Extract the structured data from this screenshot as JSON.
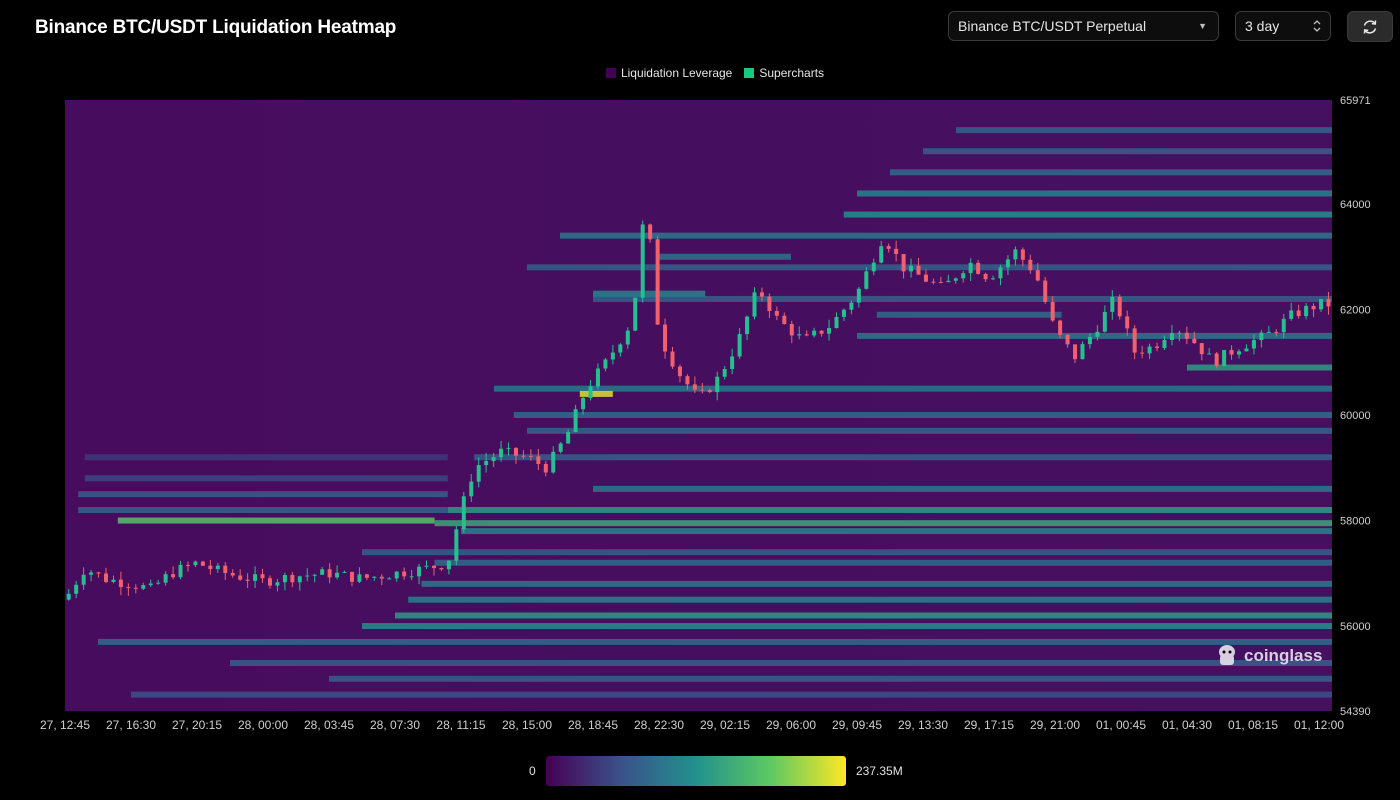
{
  "header": {
    "title": "Binance BTC/USDT Liquidation Heatmap",
    "pair_select": "Binance BTC/USDT Perpetual",
    "range_select": "3 day",
    "refresh_icon": "refresh-icon"
  },
  "legend": {
    "items": [
      {
        "label": "Liquidation Leverage",
        "color": "#440154"
      },
      {
        "label": "Supercharts",
        "color": "#1fc77e"
      }
    ]
  },
  "watermark": "coinglass",
  "colors": {
    "heatmap_low": "#440154",
    "heatmap_high": "#fde725",
    "candle_up": "#26c08e",
    "candle_down": "#f0616d"
  },
  "colorbar": {
    "min_label": "0",
    "max_label": "237.35M"
  },
  "chart_data": {
    "type": "heatmap",
    "title": "Binance BTC/USDT Liquidation Heatmap",
    "y_ticks": [
      "65971",
      "64000",
      "62000",
      "60000",
      "58000",
      "56000",
      "54390"
    ],
    "y_min": 54390,
    "y_max": 65971,
    "x_ticks": [
      "27, 12:45",
      "27, 16:30",
      "27, 20:15",
      "28, 00:00",
      "28, 03:45",
      "28, 07:30",
      "28, 11:15",
      "28, 15:00",
      "28, 18:45",
      "28, 22:30",
      "29, 02:15",
      "29, 06:00",
      "29, 09:45",
      "29, 13:30",
      "29, 17:15",
      "29, 21:00",
      "01, 00:45",
      "01, 04:30",
      "01, 08:15",
      "01, 12:00"
    ],
    "value_range": [
      0,
      237350000
    ],
    "price_path": [
      {
        "t": 0,
        "p": 56500
      },
      {
        "t": 0.3,
        "p": 57100
      },
      {
        "t": 0.6,
        "p": 56900
      },
      {
        "t": 1.0,
        "p": 56800
      },
      {
        "t": 1.3,
        "p": 56700
      },
      {
        "t": 1.6,
        "p": 57000
      },
      {
        "t": 2.0,
        "p": 57200
      },
      {
        "t": 2.3,
        "p": 57050
      },
      {
        "t": 2.6,
        "p": 56950
      },
      {
        "t": 3.0,
        "p": 56850
      },
      {
        "t": 3.5,
        "p": 56950
      },
      {
        "t": 4.0,
        "p": 57000
      },
      {
        "t": 4.5,
        "p": 56900
      },
      {
        "t": 5.0,
        "p": 57000
      },
      {
        "t": 5.5,
        "p": 57100
      },
      {
        "t": 5.8,
        "p": 57200
      },
      {
        "t": 6.0,
        "p": 58200
      },
      {
        "t": 6.2,
        "p": 59000
      },
      {
        "t": 6.6,
        "p": 59300
      },
      {
        "t": 7.0,
        "p": 59200
      },
      {
        "t": 7.3,
        "p": 59000
      },
      {
        "t": 7.6,
        "p": 59600
      },
      {
        "t": 7.9,
        "p": 60500
      },
      {
        "t": 8.2,
        "p": 61000
      },
      {
        "t": 8.6,
        "p": 61800
      },
      {
        "t": 8.8,
        "p": 64100
      },
      {
        "t": 9.0,
        "p": 61500
      },
      {
        "t": 9.3,
        "p": 60800
      },
      {
        "t": 9.6,
        "p": 60300
      },
      {
        "t": 9.9,
        "p": 60700
      },
      {
        "t": 10.2,
        "p": 61400
      },
      {
        "t": 10.5,
        "p": 62400
      },
      {
        "t": 10.8,
        "p": 61800
      },
      {
        "t": 11.2,
        "p": 61400
      },
      {
        "t": 11.6,
        "p": 61700
      },
      {
        "t": 12.0,
        "p": 62300
      },
      {
        "t": 12.4,
        "p": 63400
      },
      {
        "t": 12.7,
        "p": 62800
      },
      {
        "t": 13.0,
        "p": 62600
      },
      {
        "t": 13.3,
        "p": 62400
      },
      {
        "t": 13.7,
        "p": 62900
      },
      {
        "t": 14.0,
        "p": 62600
      },
      {
        "t": 14.4,
        "p": 63100
      },
      {
        "t": 14.7,
        "p": 62700
      },
      {
        "t": 15.0,
        "p": 61600
      },
      {
        "t": 15.3,
        "p": 61100
      },
      {
        "t": 15.6,
        "p": 61600
      },
      {
        "t": 15.9,
        "p": 62200
      },
      {
        "t": 16.2,
        "p": 61200
      },
      {
        "t": 16.5,
        "p": 61300
      },
      {
        "t": 16.8,
        "p": 61700
      },
      {
        "t": 17.1,
        "p": 61400
      },
      {
        "t": 17.4,
        "p": 61000
      },
      {
        "t": 17.8,
        "p": 61300
      },
      {
        "t": 18.2,
        "p": 61500
      },
      {
        "t": 18.6,
        "p": 61900
      },
      {
        "t": 19.0,
        "p": 62100
      },
      {
        "t": 19.2,
        "p": 62100
      }
    ],
    "liquidation_bands": [
      {
        "price": 58000,
        "t_start": 0.8,
        "t_end": 5.6,
        "level": 0.72
      },
      {
        "price": 57950,
        "t_start": 5.6,
        "t_end": 19.3,
        "level": 0.6
      },
      {
        "price": 58200,
        "t_start": 5.8,
        "t_end": 19.3,
        "level": 0.55
      },
      {
        "price": 57800,
        "t_start": 6.0,
        "t_end": 19.3,
        "level": 0.45
      },
      {
        "price": 58600,
        "t_start": 8.0,
        "t_end": 19.3,
        "level": 0.4
      },
      {
        "price": 56500,
        "t_start": 5.2,
        "t_end": 19.3,
        "level": 0.45
      },
      {
        "price": 56200,
        "t_start": 5.0,
        "t_end": 19.3,
        "level": 0.55
      },
      {
        "price": 56000,
        "t_start": 4.5,
        "t_end": 19.3,
        "level": 0.5
      },
      {
        "price": 56800,
        "t_start": 5.4,
        "t_end": 19.3,
        "level": 0.4
      },
      {
        "price": 57200,
        "t_start": 5.6,
        "t_end": 19.3,
        "level": 0.35
      },
      {
        "price": 55700,
        "t_start": 0.5,
        "t_end": 19.3,
        "level": 0.35
      },
      {
        "price": 55300,
        "t_start": 2.5,
        "t_end": 19.3,
        "level": 0.3
      },
      {
        "price": 55000,
        "t_start": 4.0,
        "t_end": 19.3,
        "level": 0.3
      },
      {
        "price": 54700,
        "t_start": 1.0,
        "t_end": 19.3,
        "level": 0.25
      },
      {
        "price": 57400,
        "t_start": 4.5,
        "t_end": 19.3,
        "level": 0.3
      },
      {
        "price": 59200,
        "t_start": 6.2,
        "t_end": 19.3,
        "level": 0.3
      },
      {
        "price": 59700,
        "t_start": 7.0,
        "t_end": 19.3,
        "level": 0.32
      },
      {
        "price": 60000,
        "t_start": 6.8,
        "t_end": 19.3,
        "level": 0.35
      },
      {
        "price": 60500,
        "t_start": 6.5,
        "t_end": 19.3,
        "level": 0.4
      },
      {
        "price": 60900,
        "t_start": 17.0,
        "t_end": 19.3,
        "level": 0.55
      },
      {
        "price": 61500,
        "t_start": 12.0,
        "t_end": 19.3,
        "level": 0.4
      },
      {
        "price": 61900,
        "t_start": 12.3,
        "t_end": 15.1,
        "level": 0.35
      },
      {
        "price": 62200,
        "t_start": 8.0,
        "t_end": 19.3,
        "level": 0.3
      },
      {
        "price": 62800,
        "t_start": 7.0,
        "t_end": 19.3,
        "level": 0.3
      },
      {
        "price": 63400,
        "t_start": 7.5,
        "t_end": 19.3,
        "level": 0.4
      },
      {
        "price": 63800,
        "t_start": 11.8,
        "t_end": 19.3,
        "level": 0.5
      },
      {
        "price": 64200,
        "t_start": 12.0,
        "t_end": 19.3,
        "level": 0.45
      },
      {
        "price": 64600,
        "t_start": 12.5,
        "t_end": 19.3,
        "level": 0.35
      },
      {
        "price": 65000,
        "t_start": 13.0,
        "t_end": 19.3,
        "level": 0.3
      },
      {
        "price": 65400,
        "t_start": 13.5,
        "t_end": 19.3,
        "level": 0.3
      },
      {
        "price": 63000,
        "t_start": 9.0,
        "t_end": 11.0,
        "level": 0.38
      },
      {
        "price": 62300,
        "t_start": 8.0,
        "t_end": 9.7,
        "level": 0.45
      },
      {
        "price": 60400,
        "t_start": 7.8,
        "t_end": 8.3,
        "level": 0.95
      },
      {
        "price": 59200,
        "t_start": 0.3,
        "t_end": 5.8,
        "level": 0.18
      },
      {
        "price": 58800,
        "t_start": 0.3,
        "t_end": 5.8,
        "level": 0.22
      },
      {
        "price": 58500,
        "t_start": 0.2,
        "t_end": 5.8,
        "level": 0.3
      },
      {
        "price": 58200,
        "t_start": 0.2,
        "t_end": 5.8,
        "level": 0.32
      }
    ]
  }
}
